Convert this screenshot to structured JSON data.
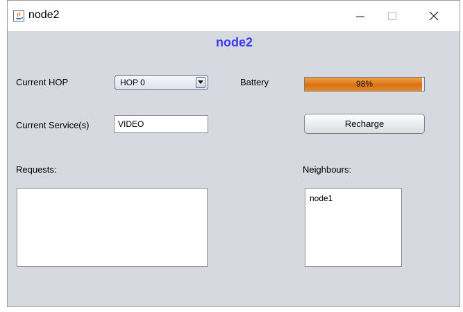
{
  "window": {
    "title": "node2",
    "app_icon": "java-icon",
    "controls": {
      "minimize": "minimize-icon",
      "maximize": "maximize-icon",
      "close": "close-icon"
    }
  },
  "heading": "node2",
  "heading_color": "#3b3bf5",
  "current_hop": {
    "label": "Current HOP",
    "selected": "HOP 0"
  },
  "battery": {
    "label": "Battery",
    "value_text": "98%",
    "level": 0.98,
    "bar_color": "#d67211"
  },
  "current_service": {
    "label": "Current Service(s)",
    "value": "VIDEO"
  },
  "recharge_button": "Recharge",
  "requests": {
    "label": "Requests:",
    "items": []
  },
  "neighbours": {
    "label": "Neighbours:",
    "items": [
      "node1"
    ]
  }
}
